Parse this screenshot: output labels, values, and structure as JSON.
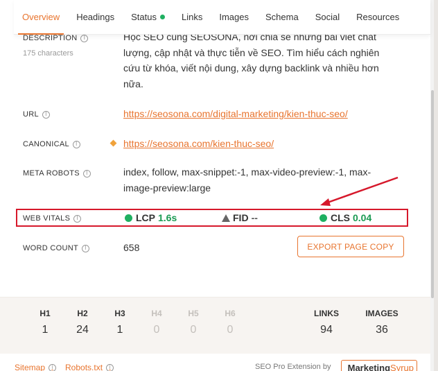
{
  "tabs": [
    {
      "label": "Overview",
      "active": true
    },
    {
      "label": "Headings",
      "active": false
    },
    {
      "label": "Status",
      "active": false,
      "status_color": "#1fb061"
    },
    {
      "label": "Links",
      "active": false
    },
    {
      "label": "Images",
      "active": false
    },
    {
      "label": "Schema",
      "active": false
    },
    {
      "label": "Social",
      "active": false
    },
    {
      "label": "Resources",
      "active": false
    }
  ],
  "description": {
    "label": "Description",
    "sublabel": "175 characters",
    "lines": [
      "Học SEO cùng SEOSONA, nơi chia sẻ những bài viết chất",
      "lượng, cập nhật và thực tiễn về SEO. Tìm hiểu cách nghiên",
      "cứu từ khóa, viết nội dung, xây dựng backlink và nhiều hơn",
      "nữa."
    ]
  },
  "url": {
    "label": "URL",
    "value": "https://seosona.com/digital-marketing/kien-thuc-seo/"
  },
  "canonical": {
    "label": "Canonical",
    "value": "https://seosona.com/kien-thuc-seo/"
  },
  "meta_robots": {
    "label": "Meta Robots",
    "lines": [
      "index, follow, max-snippet:-1, max-video-preview:-1, max-",
      "image-preview:large"
    ]
  },
  "web_vitals": {
    "label": "Web Vitals",
    "lcp": {
      "name": "LCP",
      "value": "1.6s",
      "status": "good"
    },
    "fid": {
      "name": "FID",
      "value": "--",
      "status": "na"
    },
    "cls": {
      "name": "CLS",
      "value": "0.04",
      "status": "good"
    }
  },
  "word_count": {
    "label": "Word Count",
    "value": "658"
  },
  "export_button": "EXPORT PAGE COPY",
  "stats": {
    "headings": [
      {
        "label": "H1",
        "value": "1"
      },
      {
        "label": "H2",
        "value": "24"
      },
      {
        "label": "H3",
        "value": "1"
      },
      {
        "label": "H4",
        "value": "0"
      },
      {
        "label": "H5",
        "value": "0"
      },
      {
        "label": "H6",
        "value": "0"
      }
    ],
    "links": {
      "label": "LINKS",
      "value": "94"
    },
    "images": {
      "label": "IMAGES",
      "value": "36"
    }
  },
  "footer": {
    "sitemap": "Sitemap",
    "robots": "Robots.txt",
    "credit": "SEO Pro Extension by",
    "brand_part1": "Marketing",
    "brand_part2": "Syrup"
  },
  "colors": {
    "accent": "#e8742e",
    "good": "#1a9a52",
    "highlight_border": "#d6182b"
  }
}
